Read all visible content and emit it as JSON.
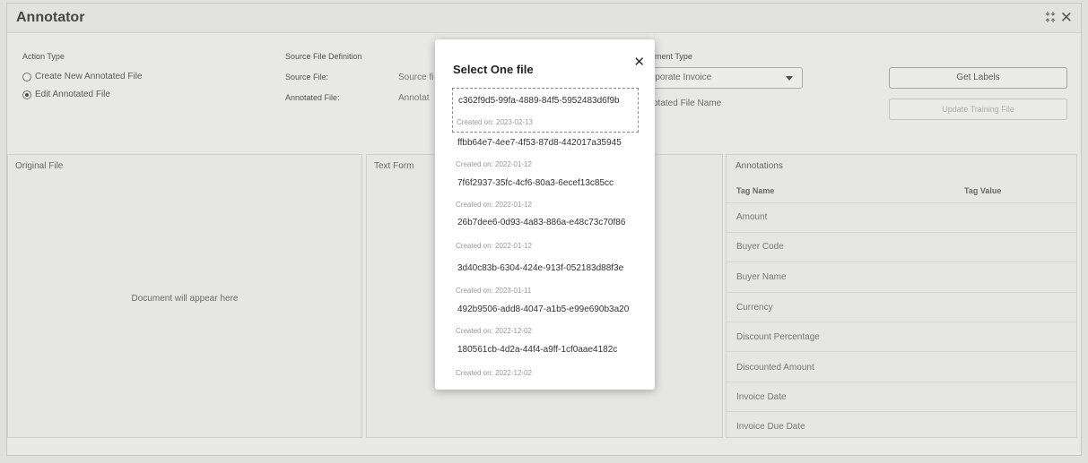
{
  "app": {
    "title": "Annotator"
  },
  "form": {
    "action_type_label": "Action Type",
    "options": [
      {
        "label": "Create New Annotated File",
        "selected": false
      },
      {
        "label": "Edit Annotated File",
        "selected": true
      }
    ],
    "source_def_label": "Source File Definition",
    "source_file_label": "Source File:",
    "annotated_file_label": "Annotated File:",
    "source_file_value": "Source fi",
    "annotated_file_value": "Annotat",
    "document_type_label": "ment Type",
    "document_type_value": "rporate Invoice",
    "annotated_file_name": "otated File Name",
    "get_labels_button": "Get Labels",
    "update_training_button": "Update Training File"
  },
  "panels": {
    "original_file": "Original File",
    "placeholder": "Document will appear here",
    "text_form": "Text Form",
    "annotations": "Annotations",
    "tag_name_header": "Tag Name",
    "tag_value_header": "Tag Value",
    "tags": [
      "Amount",
      "Buyer Code",
      "Buyer Name",
      "Currency",
      "Discount Percentage",
      "Discounted Amount",
      "Invoice Date",
      "Invoice Due Date"
    ]
  },
  "modal": {
    "title": "Select One file",
    "files": [
      {
        "id": "c362f9d5-99fa-4889-84f5-5952483d6f9b",
        "date": "Created on: 2023-02-13",
        "selected": true
      },
      {
        "id": "ffbb64e7-4ee7-4f53-87d8-442017a35945",
        "date": "Created on: 2022-01-12",
        "selected": false
      },
      {
        "id": "7f6f2937-35fc-4cf6-80a3-6ecef13c85cc",
        "date": "Created on: 2022-01-12",
        "selected": false
      },
      {
        "id": "26b7dee6-0d93-4a83-886a-e48c73c70f86",
        "date": "Created on: 2022-01-12",
        "selected": false
      },
      {
        "id": "3d40c83b-6304-424e-913f-052183d88f3e",
        "date": "Created on: 2023-01-11",
        "selected": false
      },
      {
        "id": "492b9506-add8-4047-a1b5-e99e690b3a20",
        "date": "Created on: 2022-12-02",
        "selected": false
      },
      {
        "id": "180561cb-4d2a-44f4-a9ff-1cf0aae4182c",
        "date": "Created on: 2022-12-02",
        "selected": false
      }
    ]
  },
  "icons": {
    "collapse": "collapse-icon",
    "close": "close-icon",
    "dropdown": "chevron-down-icon"
  }
}
